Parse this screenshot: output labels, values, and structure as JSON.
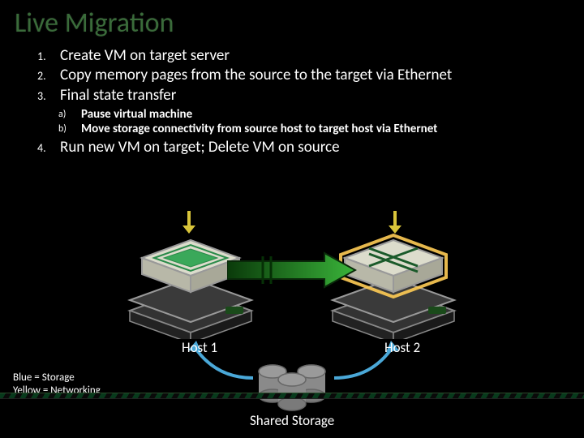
{
  "title": "Live Migration",
  "steps": {
    "s1": "Create VM on target server",
    "s2": "Copy memory pages from the source to the target via Ethernet",
    "s3": "Final state transfer",
    "s3a": "Pause virtual machine",
    "s3b": "Move storage connectivity from source host to target host via Ethernet",
    "s4": "Run new VM on target; Delete VM on source"
  },
  "nums": {
    "n1": "1.",
    "n2": "2.",
    "n3": "3.",
    "n4": "4.",
    "na": "a)",
    "nb": "b)"
  },
  "labels": {
    "host1": "Host 1",
    "host2": "Host 2",
    "storage": "Shared Storage"
  },
  "legend": {
    "line1": "Blue = Storage",
    "line2": "Yellow = Networking"
  },
  "colors": {
    "title": "#3a6b3a",
    "network": "#d8c43a",
    "storage": "#4aa8d8",
    "migrate_arrow": "#2e8b2e"
  }
}
